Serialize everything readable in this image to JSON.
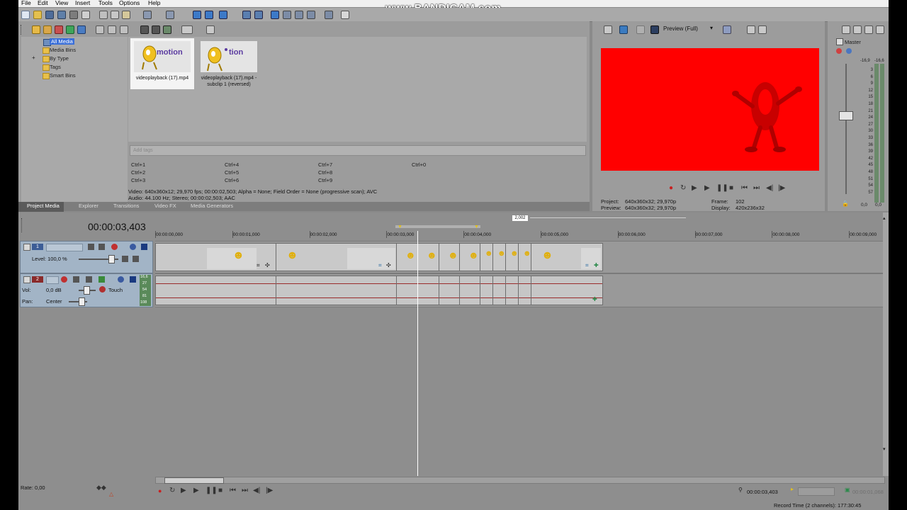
{
  "watermark": "www.BANDICAM.com",
  "menu": {
    "items": [
      "File",
      "Edit",
      "View",
      "Insert",
      "Tools",
      "Options",
      "Help"
    ]
  },
  "media": {
    "tree": [
      "All Media",
      "Media Bins",
      "By Type",
      "Tags",
      "Smart Bins"
    ],
    "tree_expand": "+",
    "thumbs": [
      {
        "logo": "motion",
        "caption": "videoplayback (17).mp4"
      },
      {
        "logo": "tion",
        "caption": "videoplayback (17).mp4 - subclip 1 (reversed)"
      }
    ],
    "tags_placeholder": "Add tags",
    "shortcuts": [
      "Ctrl+1",
      "Ctrl+2",
      "Ctrl+3",
      "Ctrl+4",
      "Ctrl+5",
      "Ctrl+6",
      "Ctrl+7",
      "Ctrl+8",
      "Ctrl+9",
      "Ctrl+0"
    ],
    "info_video": "Video: 640x360x12; 29,970 fps; 00:00:02,503; Alpha = None; Field Order = None (progressive scan); AVC",
    "info_audio": "Audio: 44.100 Hz; Stereo; 00:00:02,503; AAC"
  },
  "dock_tabs": [
    "Project Media",
    "Explorer",
    "Transitions",
    "Video FX",
    "Media Generators"
  ],
  "preview": {
    "mode": "Preview (Full)",
    "project_label": "Project:",
    "project_value": "640x360x32; 29,970p",
    "preview_label": "Preview:",
    "preview_value": "640x360x32; 29,970p",
    "frame_label": "Frame:",
    "frame_value": "102",
    "display_label": "Display:",
    "display_value": "420x236x32"
  },
  "master": {
    "label": "Master",
    "peak_l": "-16,9",
    "peak_r": "-16,6",
    "scale": [
      "3",
      "6",
      "9",
      "12",
      "15",
      "18",
      "21",
      "24",
      "27",
      "30",
      "33",
      "36",
      "39",
      "42",
      "45",
      "48",
      "51",
      "54",
      "57"
    ],
    "bottom_l": "0,0",
    "bottom_r": "0,0"
  },
  "timeline": {
    "time": "00:00:03,403",
    "loop_badge": "2,002",
    "ruler": [
      "00:00:00,000",
      "00:00:01,000",
      "00:00:02,000",
      "00:00:03,000",
      "00:00:04,000",
      "00:00:05,000",
      "00:00:06,000",
      "00:00:07,000",
      "00:00:08,000",
      "00:00:09,000"
    ],
    "video_track": {
      "number": "1",
      "level": "Level: 100,0 %"
    },
    "audio_track": {
      "number": "2",
      "vol_label": "Vol:",
      "vol_value": "0,0 dB",
      "pan_label": "Pan:",
      "pan_value": "Center",
      "mode": "Touch",
      "meter_vals": [
        "16,6",
        "27",
        "54",
        "81",
        "108"
      ]
    },
    "rate": "Rate: 0,00",
    "cursor_time": "00:00:03,403",
    "end_time": "00:00:01,068",
    "record_time": "Record Time (2 channels): 177:30:45"
  },
  "colors": {
    "preview_bg": "#ff0000",
    "track_header": "#a2b4c6",
    "wave": "#9a2b2b"
  }
}
